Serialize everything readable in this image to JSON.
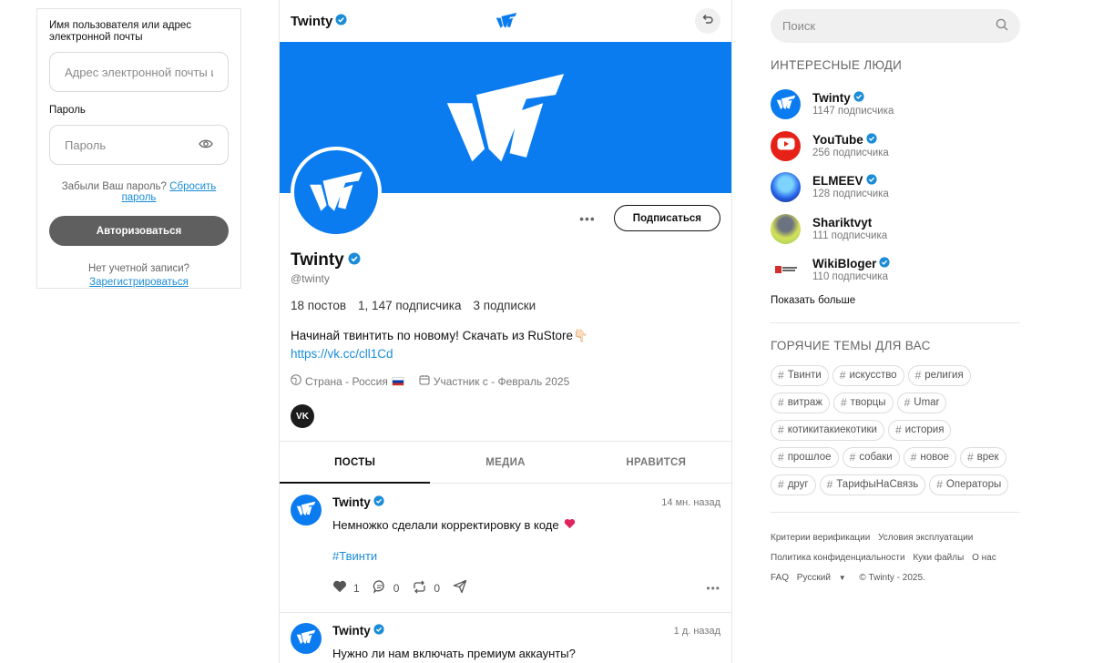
{
  "login": {
    "username_label": "Имя пользователя или адрес электронной почты",
    "username_placeholder": "Адрес электронной почты и...",
    "password_label": "Пароль",
    "password_placeholder": "Пароль",
    "forgot_text": "Забыли Ваш пароль?",
    "reset_link": "Сбросить пароль",
    "submit_label": "Авторизоваться",
    "no_account_text": "Нет учетной записи?",
    "register_link": "Зарегистрироваться"
  },
  "profile": {
    "header_name": "Twinty",
    "name": "Twinty",
    "handle": "@twinty",
    "subscribe_label": "Подписаться",
    "stats": {
      "posts": "18 постов",
      "followers": "1, 147 подписчика",
      "following": "3 подписки"
    },
    "bio": "Начинай твинтить по новому! Скачать из RuStore",
    "bio_emoji": "👇🏻",
    "link": "https://vk.cc/cll1Cd",
    "country": "Страна - Россия",
    "member_since": "Участник с - Февраль 2025",
    "social": "VK"
  },
  "tabs": [
    {
      "label": "ПОСТЫ",
      "active": true
    },
    {
      "label": "МЕДИА",
      "active": false
    },
    {
      "label": "НРАВИТСЯ",
      "active": false
    }
  ],
  "posts": [
    {
      "author": "Twinty",
      "time": "14 мн. назад",
      "text": "Немножко сделали корректировку в коде",
      "hashtag": "#Твинти",
      "likes": "1",
      "comments": "0",
      "reposts": "0"
    },
    {
      "author": "Twinty",
      "time": "1 д. назад",
      "text": "Нужно ли нам включать премиум аккаунты?"
    }
  ],
  "sidebar": {
    "search_placeholder": "Поиск",
    "people_title": "ИНТЕРЕСНЫЕ ЛЮДИ",
    "people": [
      {
        "name": "Twinty",
        "count": "1147 подписчика"
      },
      {
        "name": "YouTube",
        "count": "256 подписчика"
      },
      {
        "name": "ELMEEV",
        "count": "128 подписчика"
      },
      {
        "name": "Shariktvyt",
        "count": "111 подписчика"
      },
      {
        "name": "WikiBloger",
        "count": "110 подписчика"
      }
    ],
    "show_more": "Показать больше",
    "topics_title": "ГОРЯЧИЕ ТЕМЫ ДЛЯ ВАС",
    "topics": [
      "Твинти",
      "искусство",
      "религия",
      "витраж",
      "творцы",
      "Umar",
      "котикитакиекотики",
      "история",
      "прошлое",
      "собаки",
      "новое",
      "врек",
      "друг",
      "ТарифыНаСвязь",
      "Операторы"
    ],
    "footer": {
      "verification": "Критерии верификации",
      "terms": "Условия эксплуатации",
      "privacy": "Политика конфиденциальности",
      "cookies": "Куки файлы",
      "about": "О нас",
      "faq": "FAQ",
      "language": "Русский",
      "copyright": "© Twinty - 2025."
    }
  },
  "colors": {
    "brand": "#0a7cf0",
    "link": "#1a8cd8",
    "heart": "#e0245e",
    "button_dark": "#5f5f5f"
  }
}
